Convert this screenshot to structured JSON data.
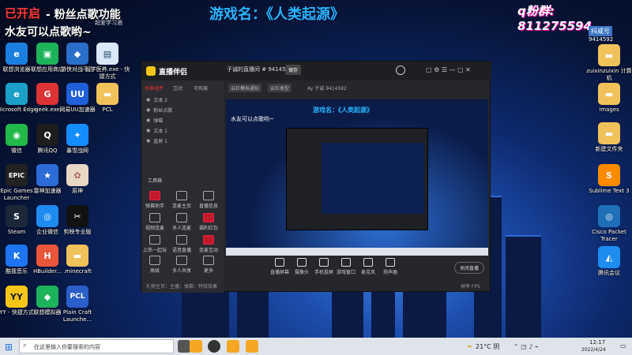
{
  "overlay": {
    "status_text": "已开启",
    "status_suffix": "- 粉丝点歌功能",
    "line2": "水友可以点歌哟~",
    "game_name": "游戏名：《人类起源》",
    "qq_group": "q粉群: 811275594",
    "top_mid_small": "超爱学习酒",
    "douyu_label": "抖咸号",
    "douyu_id": "9414592"
  },
  "desktop_left": [
    {
      "label": "联想浏览器",
      "color": "#1a7fe0",
      "glyph": "e"
    },
    {
      "label": "联想应用商店",
      "color": "#1cb35a",
      "glyph": "▣"
    },
    {
      "label": "游侠对战平台",
      "color": "#2a6fc9",
      "glyph": "◆"
    },
    {
      "label": "智学医养.exe - 快捷方式",
      "color": "#d8e8f8",
      "glyph": "▤"
    },
    {
      "label": "Microsoft Edge",
      "color": "#1aa0c8",
      "glyph": "e"
    },
    {
      "label": "geek.exe",
      "color": "#d33",
      "glyph": "G"
    },
    {
      "label": "网易UU加速器",
      "color": "#1f5fd9",
      "glyph": "UU"
    },
    {
      "label": "PCL",
      "color": "#f1c15a",
      "glyph": "▬"
    },
    {
      "label": "微信",
      "color": "#22b94a",
      "glyph": "◉"
    },
    {
      "label": "腾讯QQ",
      "color": "#1d1d1d",
      "glyph": "Q"
    },
    {
      "label": "暴雪战网",
      "color": "#148eff",
      "glyph": "✦"
    },
    {
      "label": "Epic Games Launcher",
      "color": "#222",
      "glyph": "EPIC"
    },
    {
      "label": "雷神加速器",
      "color": "#2b6cd6",
      "glyph": "★"
    },
    {
      "label": "原神",
      "color": "#e9d6c5",
      "glyph": "✿"
    },
    {
      "label": "Steam",
      "color": "#1b2838",
      "glyph": "S"
    },
    {
      "label": "企业微信",
      "color": "#1d8bf0",
      "glyph": "◎"
    },
    {
      "label": "剪映专业版",
      "color": "#111",
      "glyph": "✂"
    },
    {
      "label": "酷我音乐",
      "color": "#1d74f2",
      "glyph": "K"
    },
    {
      "label": "HBuilder...",
      "color": "#e9563a",
      "glyph": "H"
    },
    {
      "label": ".minecraft",
      "color": "#f1c15a",
      "glyph": "▬"
    },
    {
      "label": "YY - 快捷方式",
      "color": "#f5c518",
      "glyph": "YY"
    },
    {
      "label": "联想模拟器",
      "color": "#1cb35a",
      "glyph": "◆"
    },
    {
      "label": "Plain Craft Launche...",
      "color": "#2a5fc9",
      "glyph": "PCL"
    }
  ],
  "desktop_right": [
    {
      "label": "zuixinzuixin 计算机",
      "color": "#f1c15a",
      "glyph": "▬"
    },
    {
      "label": "images",
      "color": "#f1c15a",
      "glyph": "▬"
    },
    {
      "label": "新建文件夹",
      "color": "#f1c15a",
      "glyph": "▬"
    },
    {
      "label": "Sublime Text 3",
      "color": "#ff8a00",
      "glyph": "S"
    },
    {
      "label": "Cisco Packet Tracer",
      "color": "#1e6fb8",
      "glyph": "◎"
    },
    {
      "label": "腾讯会议",
      "color": "#1e8cf0",
      "glyph": "◭"
    }
  ],
  "obs": {
    "app_title": "直播伴侣",
    "room_title": "子诚的直播间 # 9414592",
    "save_label": "保存",
    "tabs": [
      "场景组件",
      "互动",
      "可拓展"
    ],
    "sources": [
      "文本 2",
      "粉丝点歌",
      "弹幕",
      "文本 1",
      "直屏 1"
    ],
    "tool_section": "工具箱",
    "tools": [
      "弹幕助手",
      "连麦主页",
      "直播信息",
      "视频连麦",
      "多人连麦",
      "福利红包",
      "上热一起玩",
      "语音直播",
      "连麦互动",
      "高级",
      "多人共享",
      "更多"
    ],
    "room_badges": [
      "云栏模拟通知",
      "云栏类型"
    ],
    "room_info": "Ay 子诚  9414592",
    "bottom_tools": [
      "直播屏幕",
      "摄像头",
      "手机投屏",
      "游戏窗口",
      "麦克风",
      "扬声器"
    ],
    "go_live": "关闭直播",
    "footer_left": "礼物主页：主播：弹幕：特效效果",
    "footer_right": "帧率 FPS"
  },
  "taskbar": {
    "search_placeholder": "在这里输入你要搜索的内容",
    "weather": "21°C 阴",
    "time": "12:17",
    "date": "2022/4/24"
  }
}
